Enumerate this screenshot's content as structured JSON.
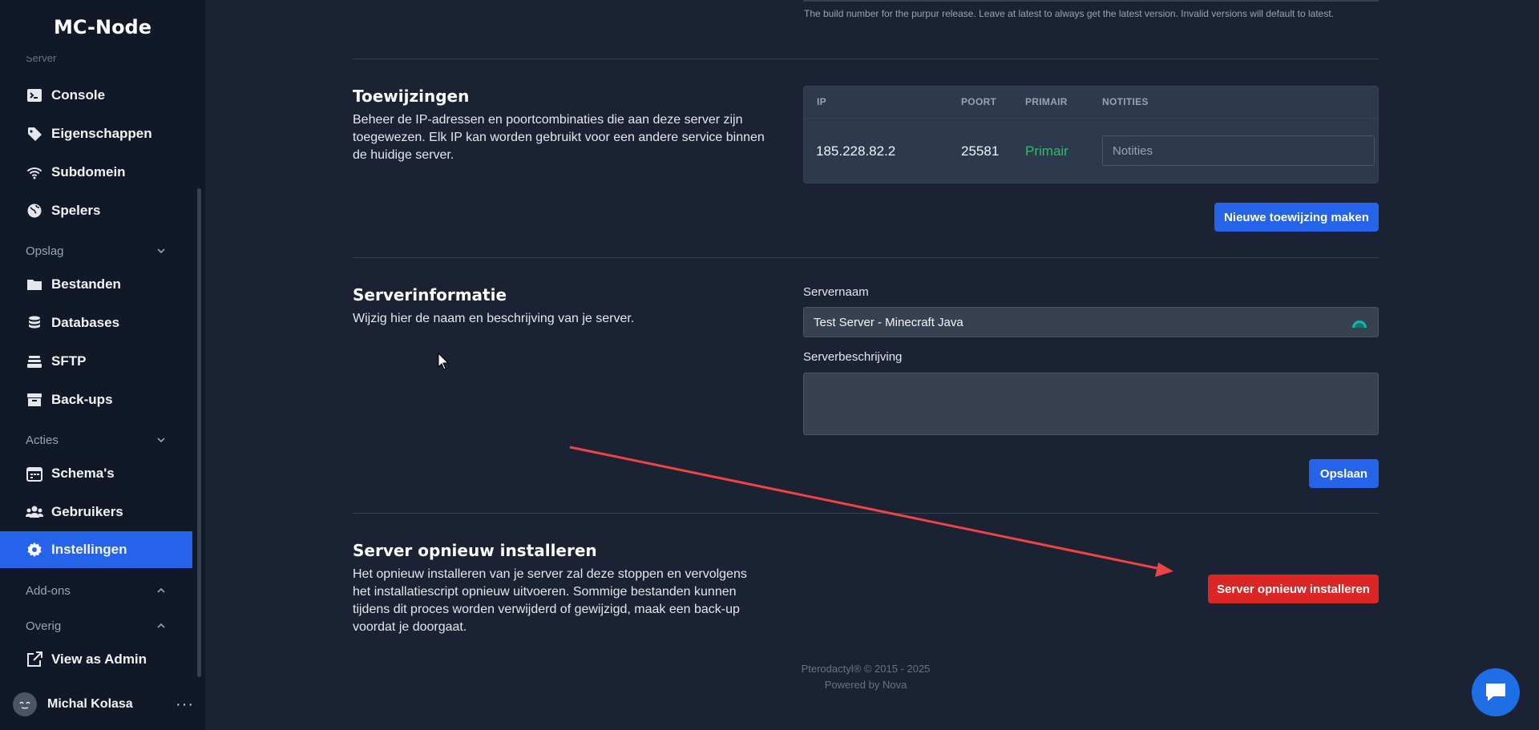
{
  "app": {
    "brand": "MC-Node"
  },
  "sidebar": {
    "cut_heading": "Server",
    "items": [
      {
        "label": "Console",
        "icon": "terminal-icon"
      },
      {
        "label": "Eigenschappen",
        "icon": "tag-icon"
      },
      {
        "label": "Subdomein",
        "icon": "wifi-icon"
      },
      {
        "label": "Spelers",
        "icon": "globe-icon"
      },
      {
        "label": "Bestanden",
        "icon": "folder-icon"
      },
      {
        "label": "Databases",
        "icon": "database-icon"
      },
      {
        "label": "SFTP",
        "icon": "stack-icon"
      },
      {
        "label": "Back-ups",
        "icon": "archive-icon"
      },
      {
        "label": "Schema's",
        "icon": "calendar-icon"
      },
      {
        "label": "Gebruikers",
        "icon": "users-icon"
      },
      {
        "label": "Instellingen",
        "icon": "gear-icon",
        "active": true
      },
      {
        "label": "View as Admin",
        "icon": "external-link-icon"
      }
    ],
    "headings": {
      "opslag": "Opslag",
      "acties": "Acties",
      "addons": "Add-ons",
      "overig": "Overig"
    },
    "user": {
      "name": "Michal Kolasa",
      "menu": "···"
    }
  },
  "main": {
    "top_hint": "The build number for the purpur release. Leave at latest to always get the latest version. Invalid versions will default to latest.",
    "allocations": {
      "title": "Toewijzingen",
      "description": "Beheer de IP-adressen en poortcombinaties die aan deze server zijn toegewezen. Elk IP kan worden gebruikt voor een andere service binnen de huidige server.",
      "columns": {
        "ip": "IP",
        "port": "POORT",
        "primary": "PRIMAIR",
        "notes": "NOTITIES"
      },
      "rows": [
        {
          "ip": "185.228.82.2",
          "port": "25581",
          "primary": "Primair",
          "notes_placeholder": "Notities"
        }
      ],
      "new_button": "Nieuwe toewijzing maken"
    },
    "server_info": {
      "title": "Serverinformatie",
      "description": "Wijzig hier de naam en beschrijving van je server.",
      "name_label": "Servernaam",
      "name_value": "Test Server - Minecraft Java",
      "desc_label": "Serverbeschrijving",
      "desc_value": "",
      "save_button": "Opslaan"
    },
    "reinstall": {
      "title": "Server opnieuw installeren",
      "description": "Het opnieuw installeren van je server zal deze stoppen en vervolgens het installatiescript opnieuw uitvoeren. Sommige bestanden kunnen tijdens dit proces worden verwijderd of gewijzigd, maak een back-up voordat je doorgaat.",
      "button": "Server opnieuw installeren"
    }
  },
  "footer": {
    "copyright": "Pterodactyl® © 2015 - 2025",
    "powered": "Powered by Nova"
  },
  "colors": {
    "accent": "#2563eb",
    "danger": "#dc2626",
    "primary_green": "#22c55e",
    "annotation_arrow": "#ef4444"
  }
}
